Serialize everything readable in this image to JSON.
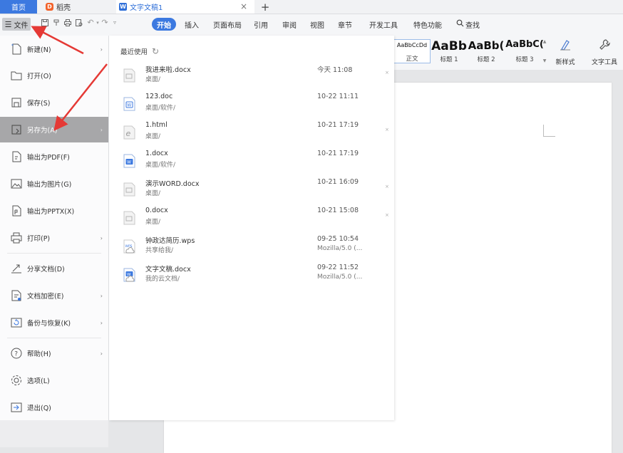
{
  "tabs": {
    "home": "首页",
    "docer": "稻壳",
    "doc_title": "文字文稿1",
    "close": "×",
    "add": "+"
  },
  "ribbon": {
    "file_label": "文件",
    "menu_tabs": [
      "开始",
      "插入",
      "页面布局",
      "引用",
      "审阅",
      "视图",
      "章节",
      "开发工具",
      "特色功能"
    ],
    "search": "查找",
    "styles": [
      {
        "preview": "AaBbCcDd",
        "name": "正文"
      },
      {
        "preview": "AaBb",
        "name": "标题 1"
      },
      {
        "preview": "AaBb(",
        "name": "标题 2"
      },
      {
        "preview": "AaBbC(",
        "name": "标题 3"
      }
    ],
    "new_style": "新样式",
    "text_tools": "文字工具"
  },
  "file_menu": {
    "items": [
      {
        "label": "新建(N)",
        "icon": "new-file-icon",
        "has_arrow": true
      },
      {
        "label": "打开(O)",
        "icon": "folder-open-icon",
        "has_arrow": false
      },
      {
        "label": "保存(S)",
        "icon": "save-icon",
        "has_arrow": false
      },
      {
        "label": "另存为(A)",
        "icon": "save-as-icon",
        "has_arrow": true,
        "selected": true
      },
      {
        "label": "输出为PDF(F)",
        "icon": "export-pdf-icon",
        "has_arrow": false
      },
      {
        "label": "输出为图片(G)",
        "icon": "export-image-icon",
        "has_arrow": false
      },
      {
        "label": "输出为PPTX(X)",
        "icon": "export-pptx-icon",
        "has_arrow": false
      },
      {
        "label": "打印(P)",
        "icon": "print-icon",
        "has_arrow": true
      },
      {
        "label": "分享文档(D)",
        "icon": "share-icon",
        "has_arrow": false
      },
      {
        "label": "文档加密(E)",
        "icon": "encrypt-icon",
        "has_arrow": true
      },
      {
        "label": "备份与恢复(K)",
        "icon": "backup-icon",
        "has_arrow": true
      },
      {
        "label": "帮助(H)",
        "icon": "help-icon",
        "has_arrow": true
      },
      {
        "label": "选项(L)",
        "icon": "options-gear-icon",
        "has_arrow": false
      },
      {
        "label": "退出(Q)",
        "icon": "exit-icon",
        "has_arrow": false
      }
    ]
  },
  "recent": {
    "header": "最近使用",
    "files": [
      {
        "name": "我进来啦.docx",
        "path": "桌面/",
        "time": "今天 11:08",
        "sub": "",
        "icon": "doc-gray-icon",
        "pin": true
      },
      {
        "name": "123.doc",
        "path": "桌面/软件/",
        "time": "10-22 11:11",
        "sub": "",
        "icon": "doc-blue-outline-icon",
        "pin": false
      },
      {
        "name": "1.html",
        "path": "桌面/",
        "time": "10-21 17:19",
        "sub": "",
        "icon": "html-file-icon",
        "pin": true
      },
      {
        "name": "1.docx",
        "path": "桌面/软件/",
        "time": "10-21 17:19",
        "sub": "",
        "icon": "doc-blue-icon",
        "pin": false
      },
      {
        "name": "演示WORD.docx",
        "path": "桌面/",
        "time": "10-21 16:09",
        "sub": "",
        "icon": "doc-gray-icon",
        "pin": true
      },
      {
        "name": "0.docx",
        "path": "桌面/",
        "time": "10-21 15:08",
        "sub": "",
        "icon": "doc-gray-icon",
        "pin": true
      },
      {
        "name": "钟政达简历.wps",
        "path": "共享给我/",
        "time": "09-25 10:54",
        "sub": "Mozilla/5.0 (...",
        "icon": "wps-cloud-file-icon",
        "pin": false
      },
      {
        "name": "文字文稿.docx",
        "path": "我的云文档/",
        "time": "09-22 11:52",
        "sub": "Mozilla/5.0 (...",
        "icon": "doc-cloud-icon",
        "pin": false
      }
    ]
  },
  "colors": {
    "accent": "#3c79e0",
    "selected_menu": "#a7a7a9",
    "annotation": "#e53935"
  }
}
